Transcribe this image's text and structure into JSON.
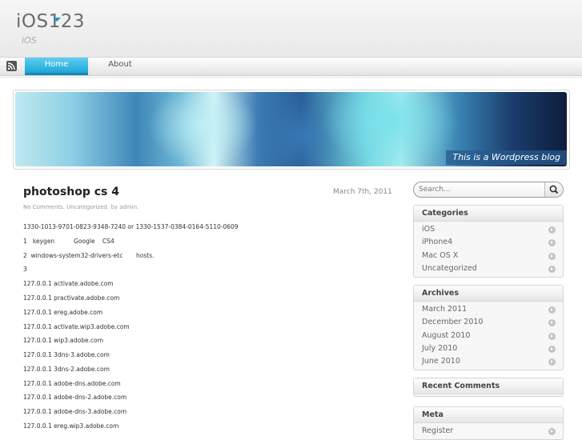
{
  "site": {
    "title": "iOS123",
    "tagline": "iOS"
  },
  "nav": {
    "rss_icon": "rss-icon",
    "items": [
      {
        "label": "Home"
      },
      {
        "label": "About"
      }
    ]
  },
  "banner": {
    "caption": "This is a Wordpress blog"
  },
  "post": {
    "title": "photoshop cs 4",
    "date": "March 7th, 2011",
    "meta": "No Comments. Uncategorized. by admin.",
    "lines": [
      "1330-1013-9701-0823-9348-7240 or 1330-1537-0384-0164-5110-0609",
      "1   keygen          Google    CS4",
      "2  windows-system32-drivers-etc       hosts.",
      "3",
      "127.0.0.1 activate.adobe.com",
      "127.0.0.1 practivate.adobe.com",
      "127.0.0.1 ereg.adobe.com",
      "127.0.0.1 activate.wip3.adobe.com",
      "127.0.0.1 wip3.adobe.com",
      "127.0.0.1 3dns-3.adobe.com",
      "127.0.0.1 3dns-2.adobe.com",
      "127.0.0.1 adobe-dns.adobe.com",
      "127.0.0.1 adobe-dns-2.adobe.com",
      "127.0.0.1 adobe-dns-3.adobe.com",
      "127.0.0.1 ereg.wip3.adobe.com"
    ]
  },
  "sidebar": {
    "search": {
      "placeholder": "Search...",
      "icon": "magnifier-icon"
    },
    "categories": {
      "title": "Categories",
      "items": [
        "iOS",
        "iPhone4",
        "Mac OS X",
        "Uncategorized"
      ]
    },
    "archives": {
      "title": "Archives",
      "items": [
        "March 2011",
        "December 2010",
        "August 2010",
        "July 2010",
        "June 2010"
      ]
    },
    "recent_comments": {
      "title": "Recent Comments"
    },
    "meta": {
      "title": "Meta",
      "items": [
        "Register"
      ]
    }
  }
}
